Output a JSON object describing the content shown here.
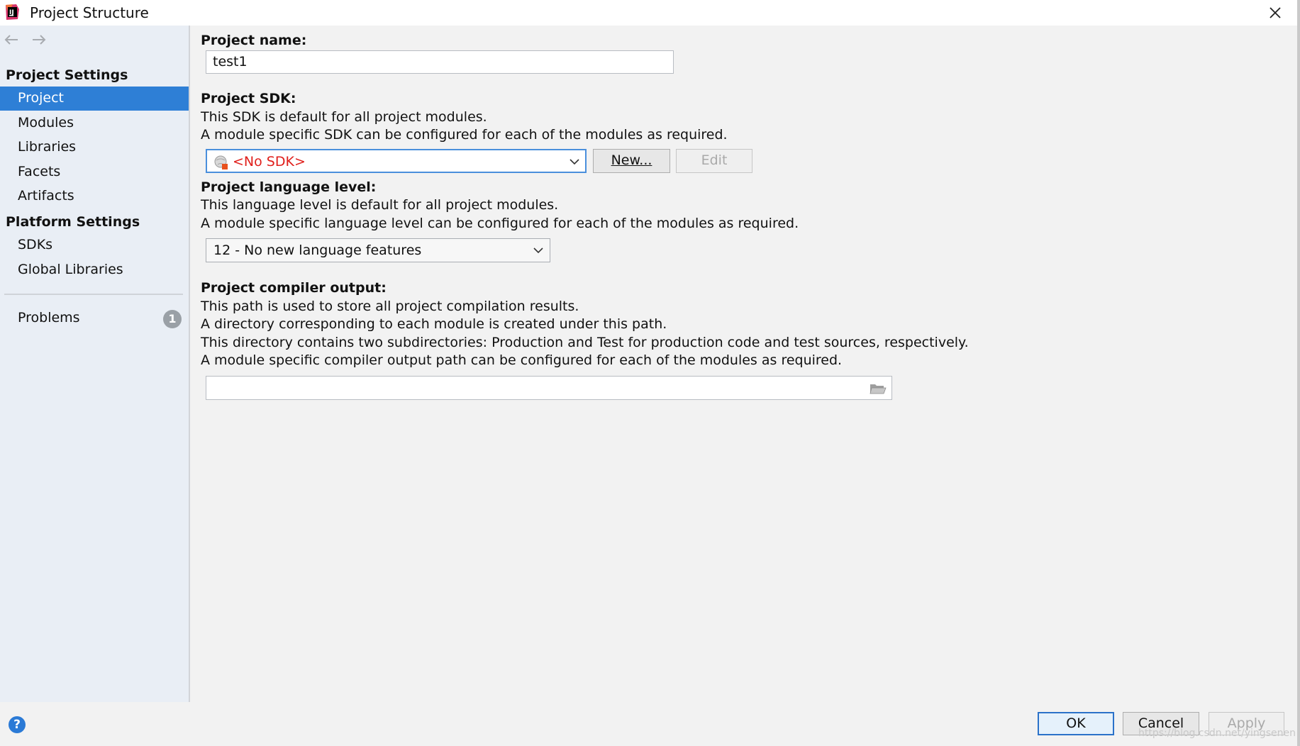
{
  "window": {
    "title": "Project Structure"
  },
  "sidebar": {
    "project_settings_heading": "Project Settings",
    "project_settings_items": [
      {
        "label": "Project",
        "selected": true
      },
      {
        "label": "Modules"
      },
      {
        "label": "Libraries"
      },
      {
        "label": "Facets"
      },
      {
        "label": "Artifacts"
      }
    ],
    "platform_settings_heading": "Platform Settings",
    "platform_settings_items": [
      {
        "label": "SDKs"
      },
      {
        "label": "Global Libraries"
      }
    ],
    "problems": {
      "label": "Problems",
      "count": "1"
    },
    "help_label": "?"
  },
  "main": {
    "project_name": {
      "label": "Project name:",
      "value": "test1"
    },
    "project_sdk": {
      "label": "Project SDK:",
      "desc_lines": [
        "This SDK is default for all project modules.",
        "A module specific SDK can be configured for each of the modules as required."
      ],
      "selected": "<No SDK>",
      "selected_color": "#e0201c",
      "new_button": "New...",
      "edit_button": "Edit"
    },
    "language_level": {
      "label": "Project language level:",
      "desc_lines": [
        "This language level is default for all project modules.",
        "A module specific language level can be configured for each of the modules as required."
      ],
      "selected": "12 - No new language features"
    },
    "compiler_output": {
      "label": "Project compiler output:",
      "desc_lines": [
        "This path is used to store all project compilation results.",
        "A directory corresponding to each module is created under this path.",
        "This directory contains two subdirectories: Production and Test for production code and test sources, respectively.",
        "A module specific compiler output path can be configured for each of the modules as required."
      ],
      "value": ""
    }
  },
  "footer": {
    "ok": "OK",
    "cancel": "Cancel",
    "apply": "Apply",
    "watermark": "https://blog.csdn.net/yingsenen"
  },
  "colors": {
    "selection": "#2e7fd6",
    "sidebar_bg": "#e9eef5",
    "accent_border": "#4a8fdc"
  }
}
